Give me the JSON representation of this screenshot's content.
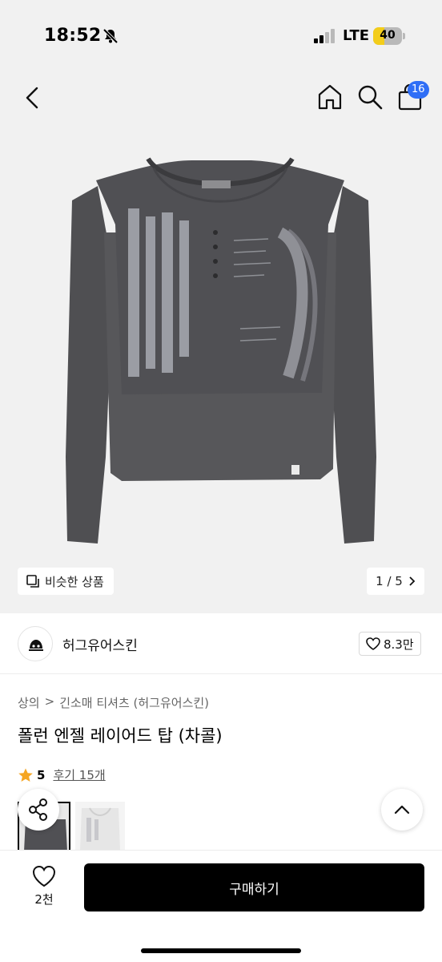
{
  "status_bar": {
    "time": "18:52",
    "network": "LTE",
    "battery": "40",
    "battery_level": 0.4
  },
  "header": {
    "cart_count": "16",
    "icons": [
      "back-icon",
      "home-icon",
      "search-icon",
      "cart-icon"
    ]
  },
  "gallery": {
    "similar_label": "비슷한 상품",
    "pager": "1 / 5"
  },
  "brand": {
    "name": "허그유어스킨",
    "likes": "8.3만"
  },
  "product": {
    "breadcrumb": [
      "상의",
      ">",
      "긴소매 티셔츠 (허그유어스킨)"
    ],
    "title": "폴런 엔젤 레이어드 탑 (차콜)",
    "rating": "5",
    "review_label": "후기 15개"
  },
  "bottom_bar": {
    "wish_count": "2천",
    "buy_label": "구매하기"
  },
  "colors": {
    "accent_badge": "#2f6ef6",
    "star": "#f5a623",
    "buy_button": "#000000",
    "image_bg": "#f1f1f1"
  }
}
